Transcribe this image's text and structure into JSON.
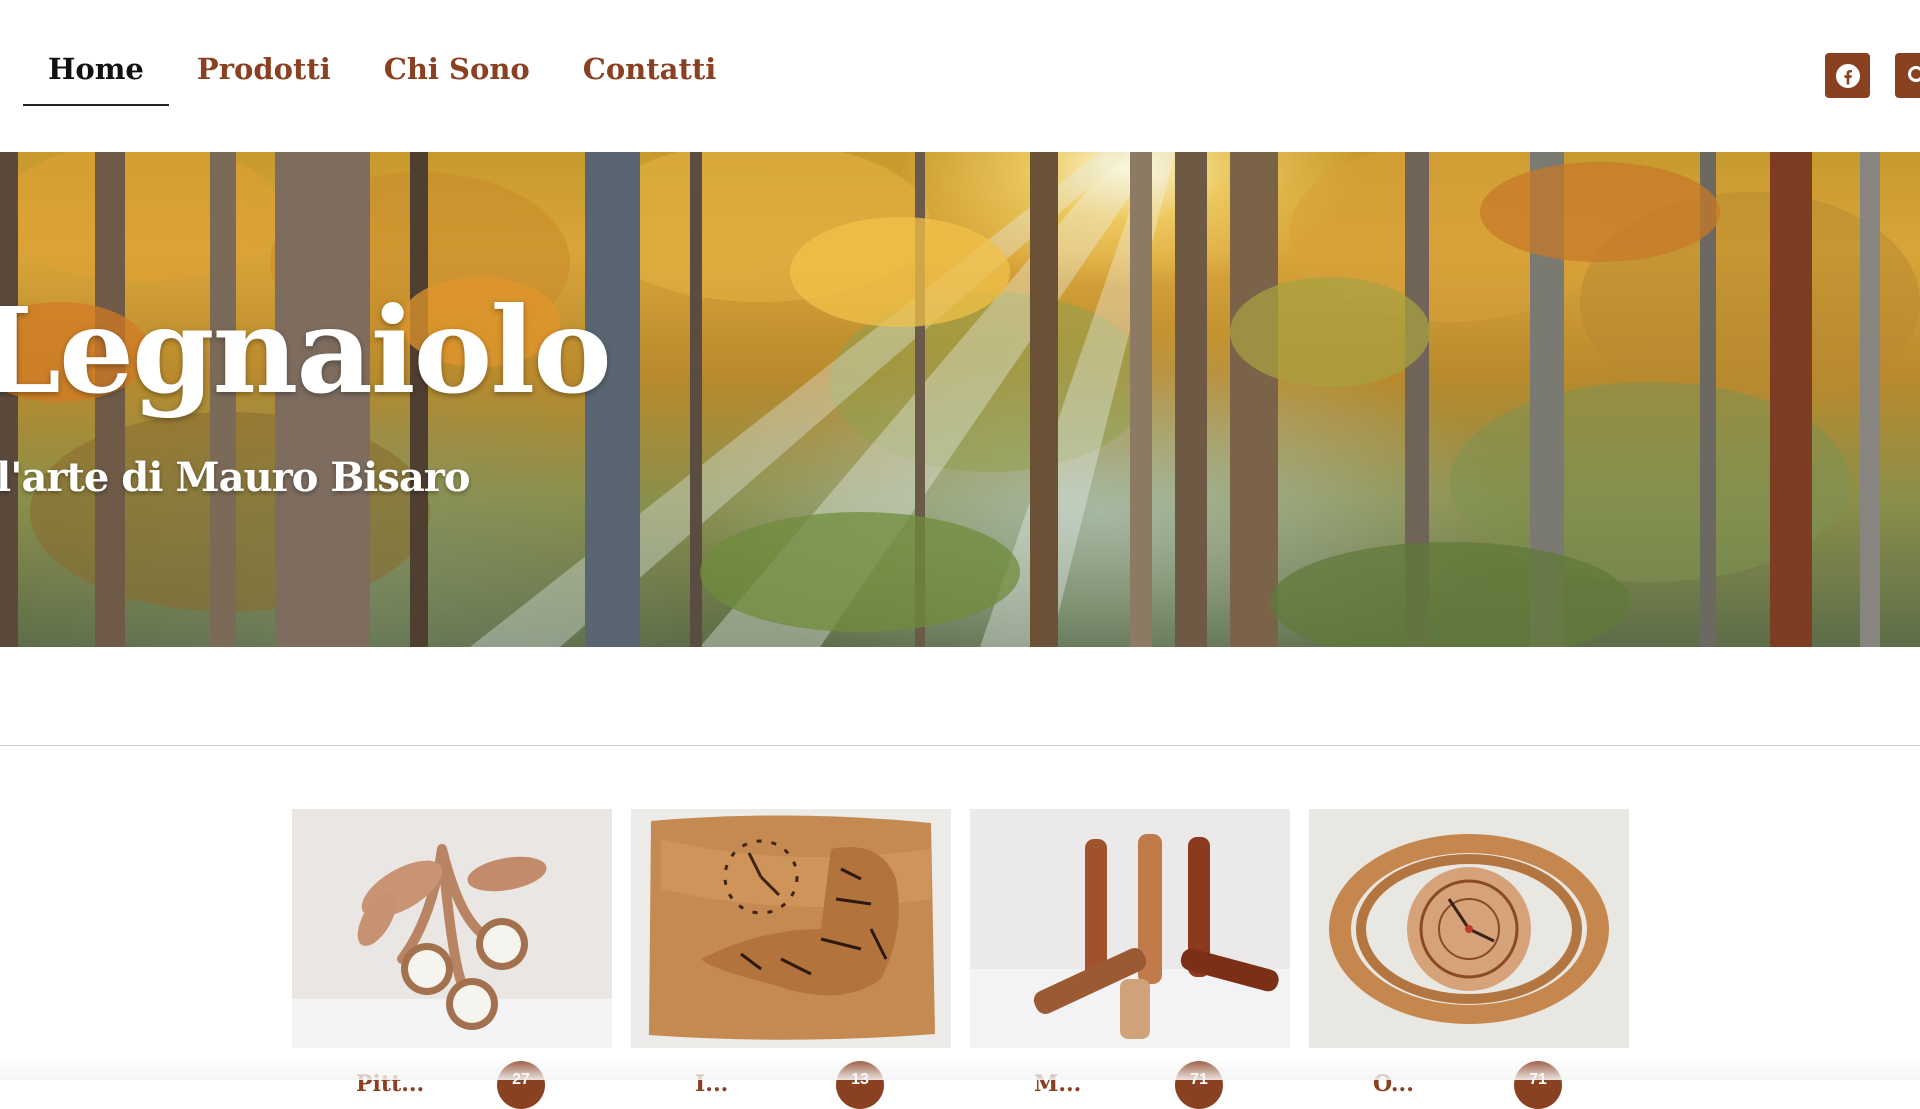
{
  "nav": {
    "items": [
      {
        "label": "Home",
        "active": true
      },
      {
        "label": "Prodotti",
        "active": false
      },
      {
        "label": "Chi Sono",
        "active": false
      },
      {
        "label": "Contatti",
        "active": false
      }
    ]
  },
  "social": {
    "facebook_icon": "facebook-icon",
    "search_icon": "search-icon"
  },
  "hero": {
    "title": "Legnaiolo",
    "subtitle": "l'arte di Mauro Bisaro",
    "background": "autumn forest with sunbeams"
  },
  "categories": [
    {
      "label": "Pitt...",
      "count": "27",
      "image": "wooden cherries barometer"
    },
    {
      "label": "I...",
      "count": "13",
      "image": "tiger wood clock"
    },
    {
      "label": "M...",
      "count": "71",
      "image": "wooden pepper mills"
    },
    {
      "label": "O...",
      "count": "71",
      "image": "celtic knot wooden clock"
    }
  ],
  "colors": {
    "accent": "#8a4122",
    "nav_active": "#111111",
    "background": "#ffffff"
  }
}
